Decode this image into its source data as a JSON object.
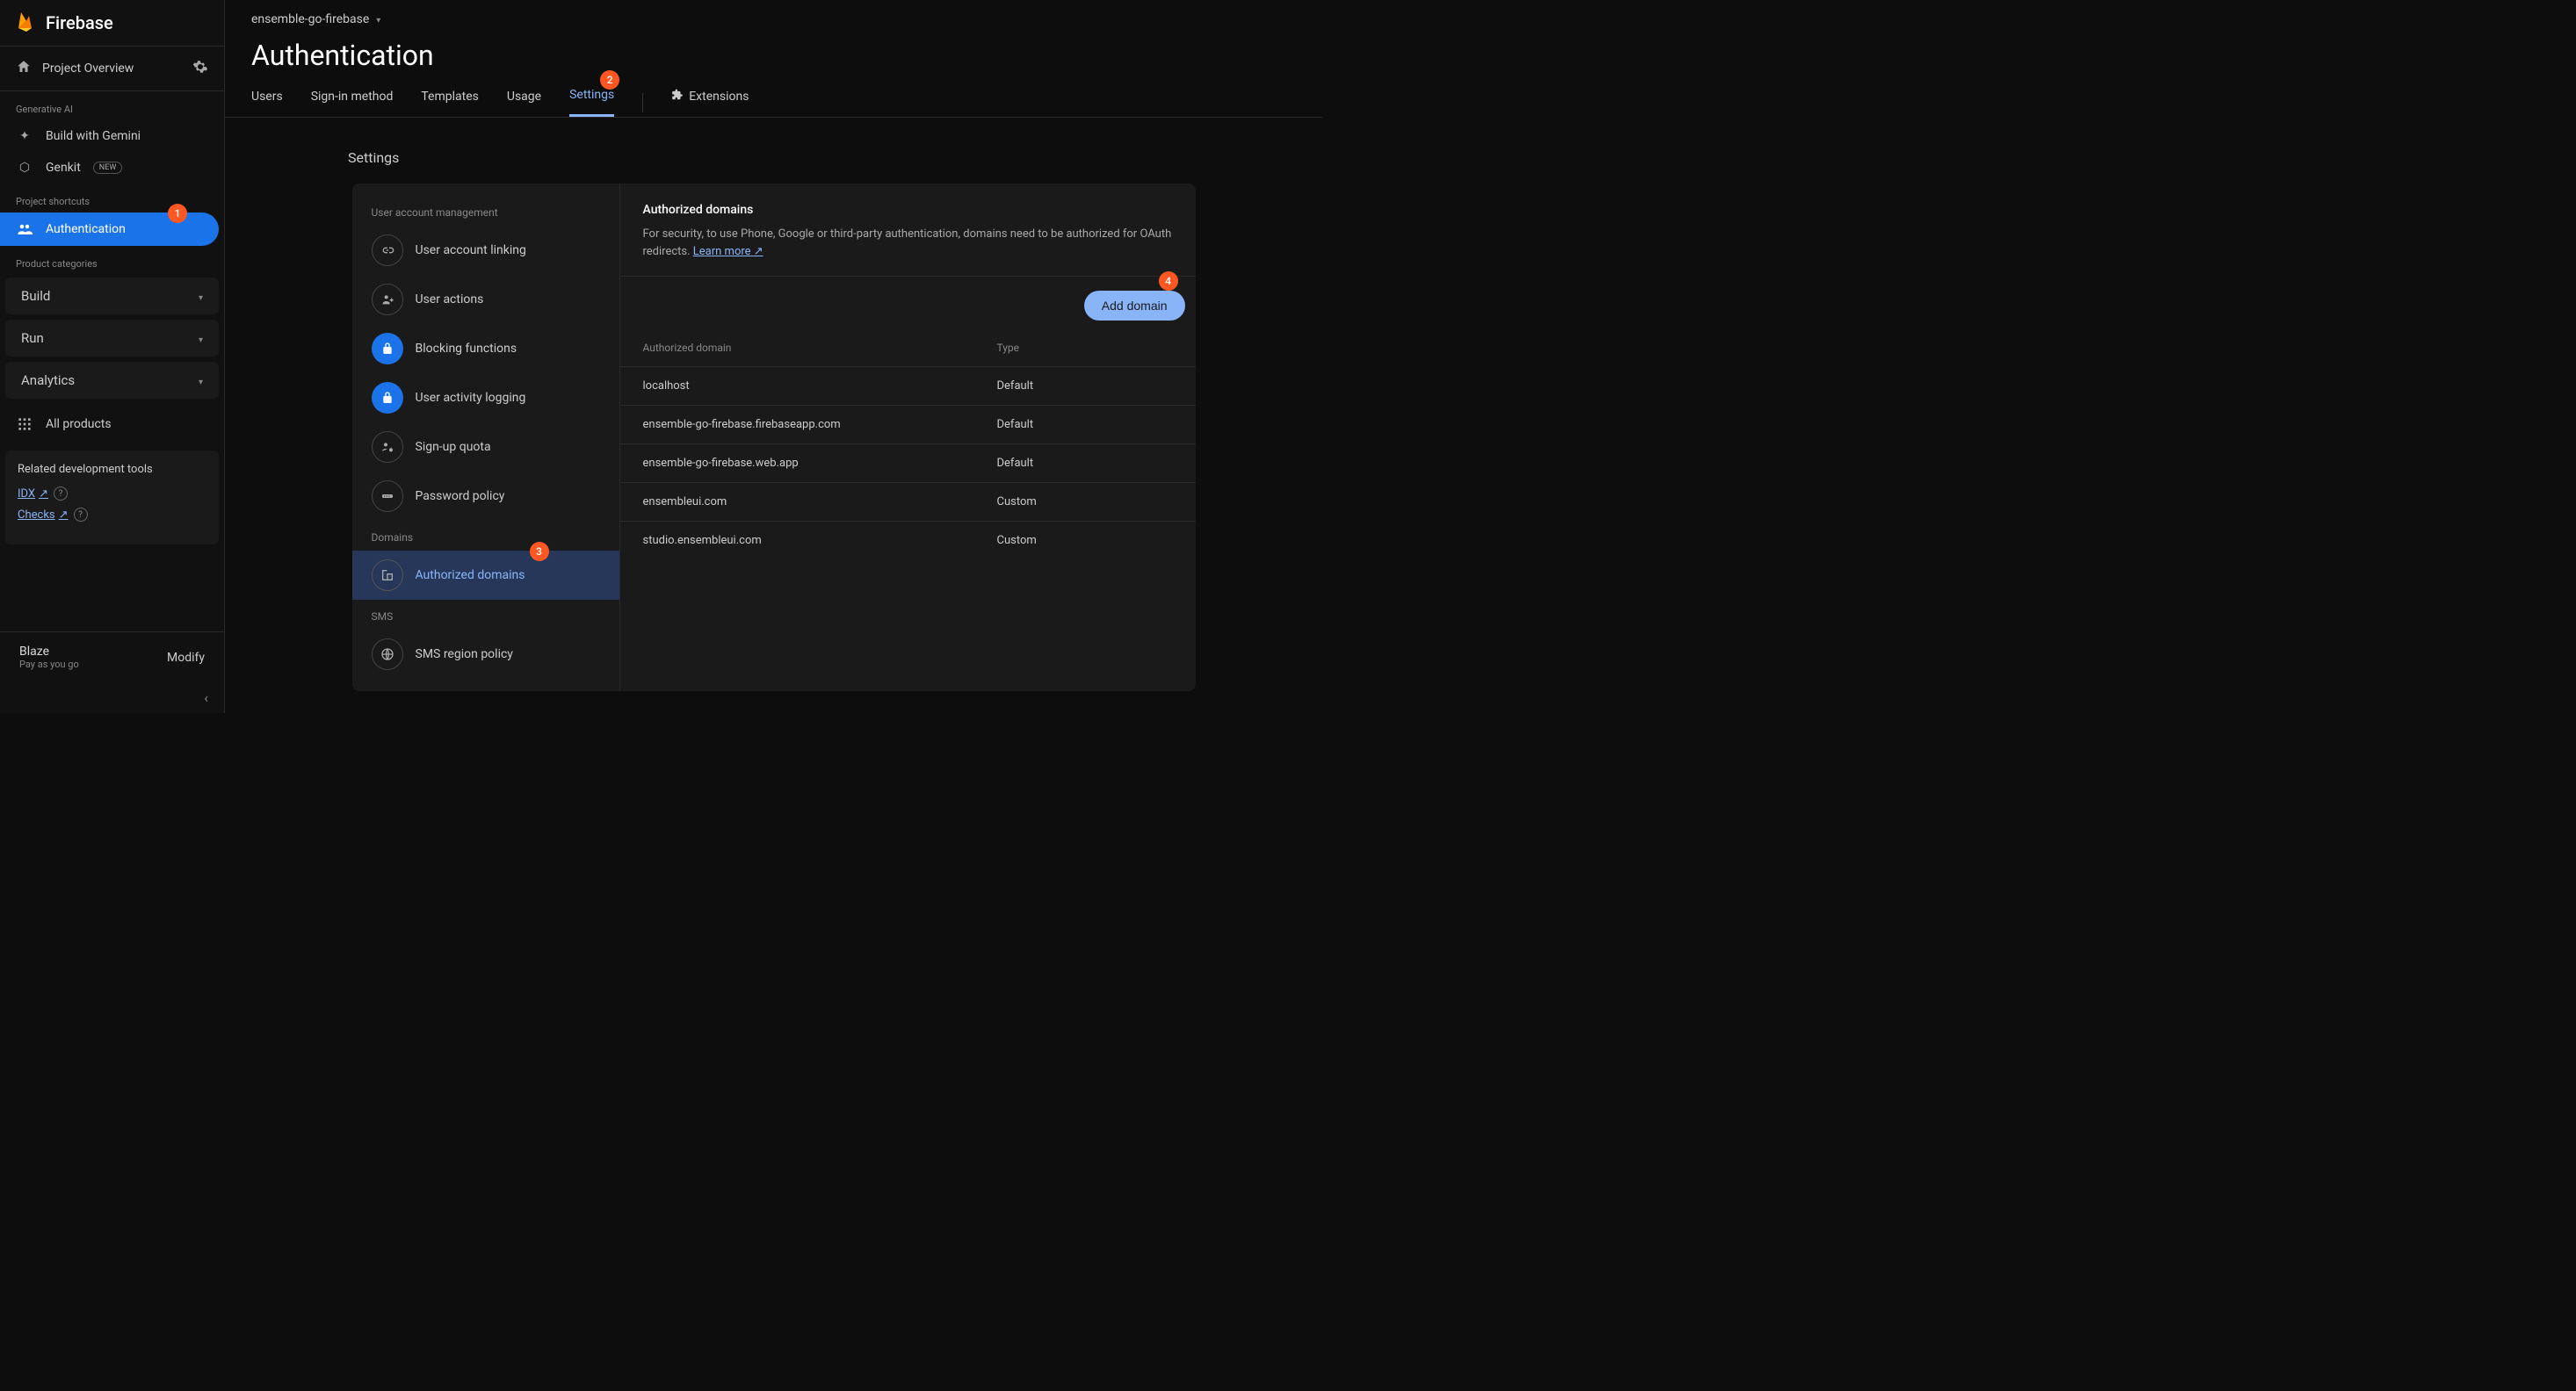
{
  "brand": "Firebase",
  "project_overview": "Project Overview",
  "sections": {
    "generative_ai": "Generative AI",
    "project_shortcuts": "Project shortcuts",
    "product_categories": "Product categories"
  },
  "nav": {
    "build_gemini": "Build with Gemini",
    "genkit": "Genkit",
    "genkit_badge": "NEW",
    "authentication": "Authentication",
    "build": "Build",
    "run": "Run",
    "analytics": "Analytics",
    "all_products": "All products"
  },
  "dev_tools": {
    "title": "Related development tools",
    "idx": "IDX",
    "checks": "Checks"
  },
  "footer": {
    "plan": "Blaze",
    "sub": "Pay as you go",
    "modify": "Modify"
  },
  "project_name": "ensemble-go-firebase",
  "page_title": "Authentication",
  "tabs": {
    "users": "Users",
    "signin": "Sign-in method",
    "templates": "Templates",
    "usage": "Usage",
    "settings": "Settings",
    "extensions": "Extensions"
  },
  "settings_heading": "Settings",
  "settings_nav": {
    "cat_user": "User account management",
    "linking": "User account linking",
    "actions": "User actions",
    "blocking": "Blocking functions",
    "activity": "User activity logging",
    "quota": "Sign-up quota",
    "password": "Password policy",
    "cat_domains": "Domains",
    "authorized": "Authorized domains",
    "cat_sms": "SMS",
    "sms_policy": "SMS region policy"
  },
  "body": {
    "title": "Authorized domains",
    "desc": "For security, to use Phone, Google or third-party authentication, domains need to be authorized for OAuth redirects. ",
    "learn_more": "Learn more",
    "add_btn": "Add domain",
    "col_domain": "Authorized domain",
    "col_type": "Type"
  },
  "domains": [
    {
      "name": "localhost",
      "type": "Default"
    },
    {
      "name": "ensemble-go-firebase.firebaseapp.com",
      "type": "Default"
    },
    {
      "name": "ensemble-go-firebase.web.app",
      "type": "Default"
    },
    {
      "name": "ensembleui.com",
      "type": "Custom"
    },
    {
      "name": "studio.ensembleui.com",
      "type": "Custom"
    }
  ],
  "badges": {
    "b1": "1",
    "b2": "2",
    "b3": "3",
    "b4": "4"
  }
}
